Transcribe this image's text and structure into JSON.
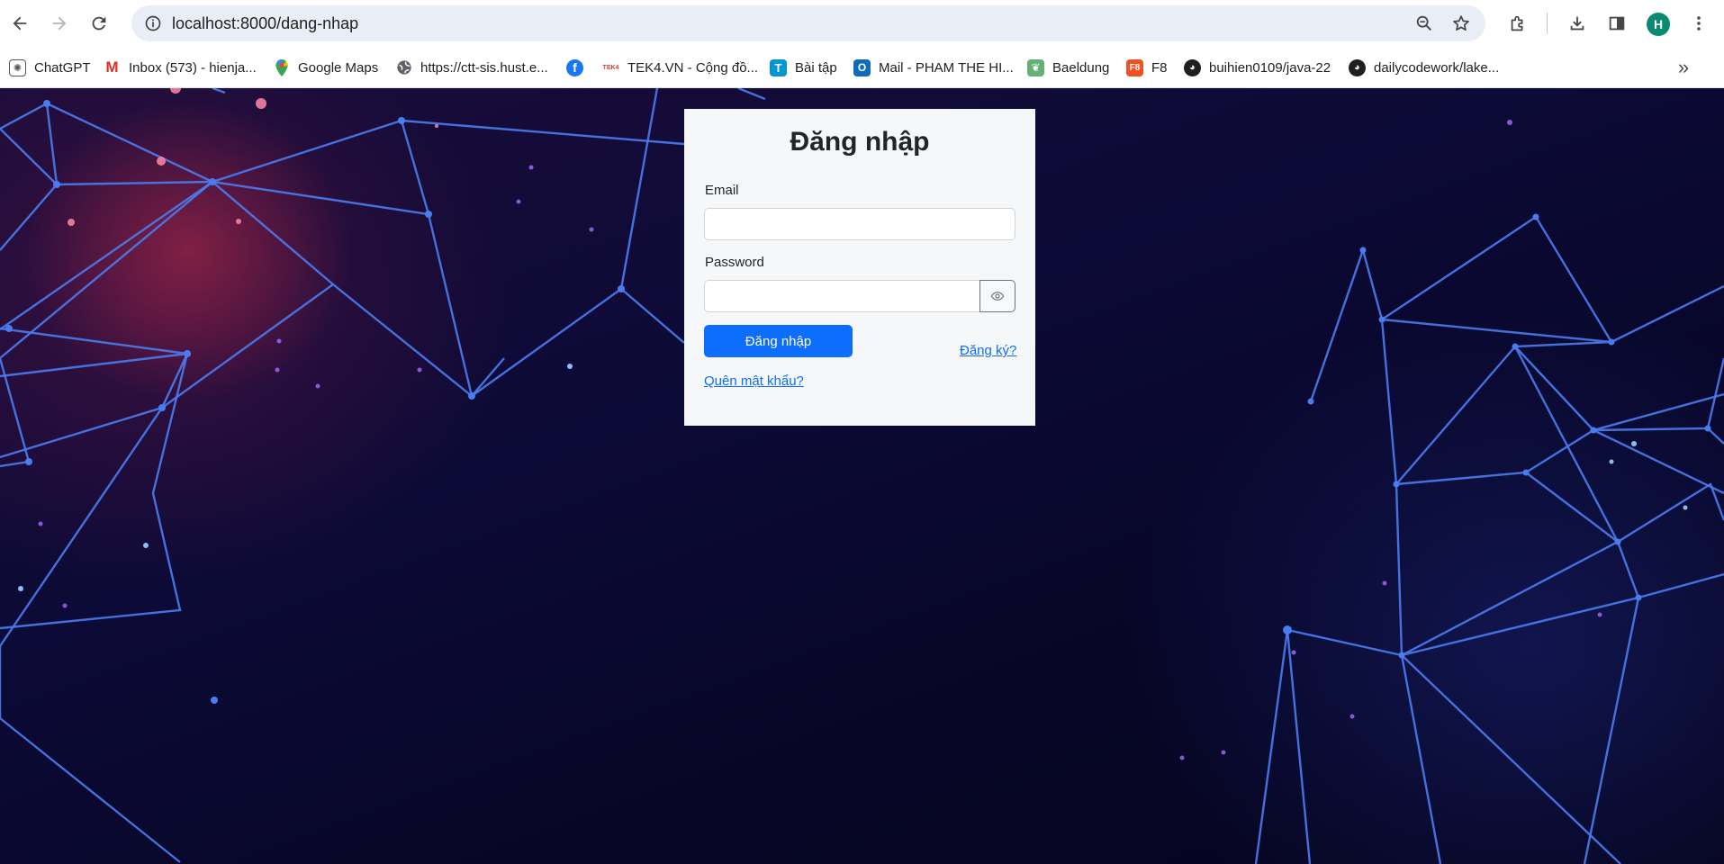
{
  "browser": {
    "url": "localhost:8000/dang-nhap",
    "profile_initial": "H",
    "bookmarks": [
      {
        "label": "ChatGPT",
        "icon": "chatgpt-icon"
      },
      {
        "label": "Inbox (573) - hienja...",
        "icon": "gmail-icon"
      },
      {
        "label": "Google Maps",
        "icon": "google-maps-icon"
      },
      {
        "label": "https://ctt-sis.hust.e...",
        "icon": "globe-icon"
      },
      {
        "label": "",
        "icon": "facebook-icon"
      },
      {
        "label": "TEK4.VN - Cộng đồ...",
        "icon": "tek4-icon"
      },
      {
        "label": "Bài tập",
        "icon": "tasks-icon"
      },
      {
        "label": "Mail - PHAM THE HI...",
        "icon": "outlook-icon"
      },
      {
        "label": "Baeldung",
        "icon": "baeldung-icon"
      },
      {
        "label": "F8",
        "icon": "f8-icon"
      },
      {
        "label": "buihien0109/java-22",
        "icon": "github-icon"
      },
      {
        "label": "dailycodework/lake...",
        "icon": "github-icon"
      }
    ]
  },
  "login": {
    "title": "Đăng nhập",
    "email_label": "Email",
    "email_value": "",
    "password_label": "Password",
    "password_value": "",
    "submit_label": "Đăng nhập",
    "register_link": "Đăng ký?",
    "forgot_link": "Quên mật khẩu?"
  },
  "colors": {
    "primary": "#0d6efd",
    "card_bg": "#f6f7f9",
    "avatar": "#0b8a72",
    "network_lines": "#4a7cf0"
  }
}
